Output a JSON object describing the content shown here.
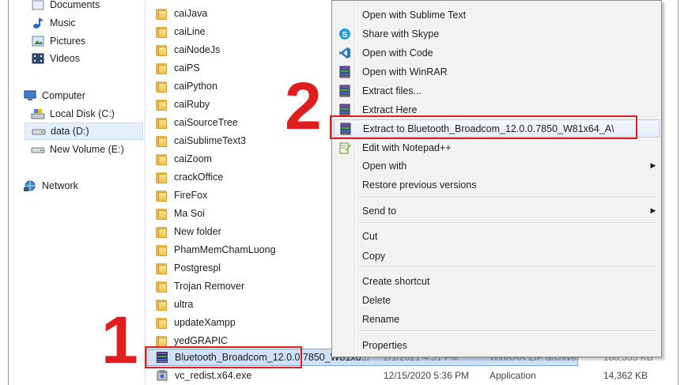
{
  "navigation": {
    "items": [
      {
        "label": "Documents",
        "icon": "documents-icon"
      },
      {
        "label": "Music",
        "icon": "music-icon"
      },
      {
        "label": "Pictures",
        "icon": "pictures-icon"
      },
      {
        "label": "Videos",
        "icon": "videos-icon"
      },
      {
        "label": "Computer",
        "icon": "computer-icon"
      },
      {
        "label": "Local Disk (C:)",
        "icon": "local-disk-icon"
      },
      {
        "label": "data (D:)",
        "icon": "drive-icon",
        "selected": true
      },
      {
        "label": "New Volume (E:)",
        "icon": "drive-icon"
      },
      {
        "label": "Network",
        "icon": "network-icon"
      }
    ]
  },
  "files": {
    "folders": [
      "caiJava",
      "caiLine",
      "caiNodeJs",
      "caiPS",
      "caiPython",
      "caiRuby",
      "caiSourceTree",
      "caiSublimeText3",
      "caiZoom",
      "crackOffice",
      "FireFox",
      "Ma Soi",
      "New folder",
      "PhamMemChamLuong",
      "Postgrespl",
      "Trojan Remover",
      "ultra",
      "updateXampp",
      "yedGRAPIC"
    ],
    "selected_file": {
      "name": "Bluetooth_Broadcom_12.0.0.7850_W81x6...",
      "date": "2/1/2021 4:51 PM",
      "type": "WinRAR ZIP archive",
      "size": "188,355 KB"
    },
    "last_file": {
      "name": "vc_redist.x64.exe",
      "date": "12/15/2020 5:36 PM",
      "type": "Application",
      "size": "14,362 KB"
    }
  },
  "context_menu": {
    "items": [
      {
        "label": "Open with Sublime Text",
        "icon": ""
      },
      {
        "label": "Share with Skype",
        "icon": "skype-icon"
      },
      {
        "label": "Open with Code",
        "icon": "vscode-icon"
      },
      {
        "label": "Open with WinRAR",
        "icon": "winrar-icon"
      },
      {
        "label": "Extract files...",
        "icon": "winrar-icon"
      },
      {
        "label": "Extract Here",
        "icon": "winrar-icon"
      },
      {
        "label": "Extract to Bluetooth_Broadcom_12.0.0.7850_W81x64_A\\",
        "icon": "winrar-icon",
        "highlighted": true
      },
      {
        "label": "Edit with Notepad++",
        "icon": "notepadpp-icon"
      },
      {
        "label": "Open with",
        "icon": "",
        "submenu": true
      },
      {
        "label": "Restore previous versions",
        "icon": ""
      },
      {
        "label": "Send to",
        "icon": "",
        "submenu": true
      },
      {
        "label": "Cut",
        "icon": ""
      },
      {
        "label": "Copy",
        "icon": ""
      },
      {
        "label": "Create shortcut",
        "icon": ""
      },
      {
        "label": "Delete",
        "icon": ""
      },
      {
        "label": "Rename",
        "icon": ""
      },
      {
        "label": "Properties",
        "icon": ""
      }
    ]
  },
  "annotations": {
    "step1": "1",
    "step2": "2",
    "highlight_color": "#e01e1e"
  }
}
